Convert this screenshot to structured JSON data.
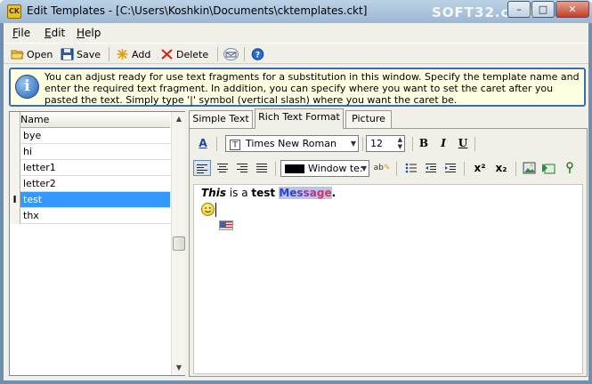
{
  "window": {
    "title": "Edit Templates - [C:\\Users\\Koshkin\\Documents\\cktemplates.ckt]",
    "app_icon_text": "CK",
    "watermark": "SOFT32.com",
    "controls": {
      "minimize": "–",
      "maximize": "□",
      "close": "✕"
    }
  },
  "menu": [
    {
      "label": "File",
      "accel": "F",
      "rest": "ile"
    },
    {
      "label": "Edit",
      "accel": "E",
      "rest": "dit"
    },
    {
      "label": "Help",
      "accel": "H",
      "rest": "elp"
    }
  ],
  "toolbar": {
    "open": "Open",
    "save": "Save",
    "add": "Add",
    "delete": "Delete"
  },
  "info": {
    "text": "You can adjust ready for use text fragments for a substitution in this window. Specify the template name and enter the required text fragment. In addition, you can specify where you want to set the caret after you pasted the text. Simply type '|' symbol (vertical slash) where you want the caret be."
  },
  "list": {
    "header": "Name",
    "items": [
      "bye",
      "hi",
      "letter1",
      "letter2",
      "test",
      "thx"
    ],
    "selected_index": 4
  },
  "tabs": [
    "Simple Text",
    "Rich Text Format",
    "Picture"
  ],
  "active_tab": 1,
  "format": {
    "font_name": "Times New Roman",
    "font_size": "12",
    "bold": "B",
    "italic": "I",
    "underline": "U",
    "color_name": "Window te:",
    "superscript": "x²",
    "subscript": "x₂"
  },
  "document": {
    "italic_word": "This",
    "part1": " is a ",
    "bold_word": "test",
    "space": " ",
    "colored_word": "Message",
    "period": "."
  },
  "colors": {
    "selection": "#3399ff",
    "info_border": "#3a6ea8",
    "info_bg": "#ffffe1",
    "message_highlight": "#b8c8e0"
  }
}
